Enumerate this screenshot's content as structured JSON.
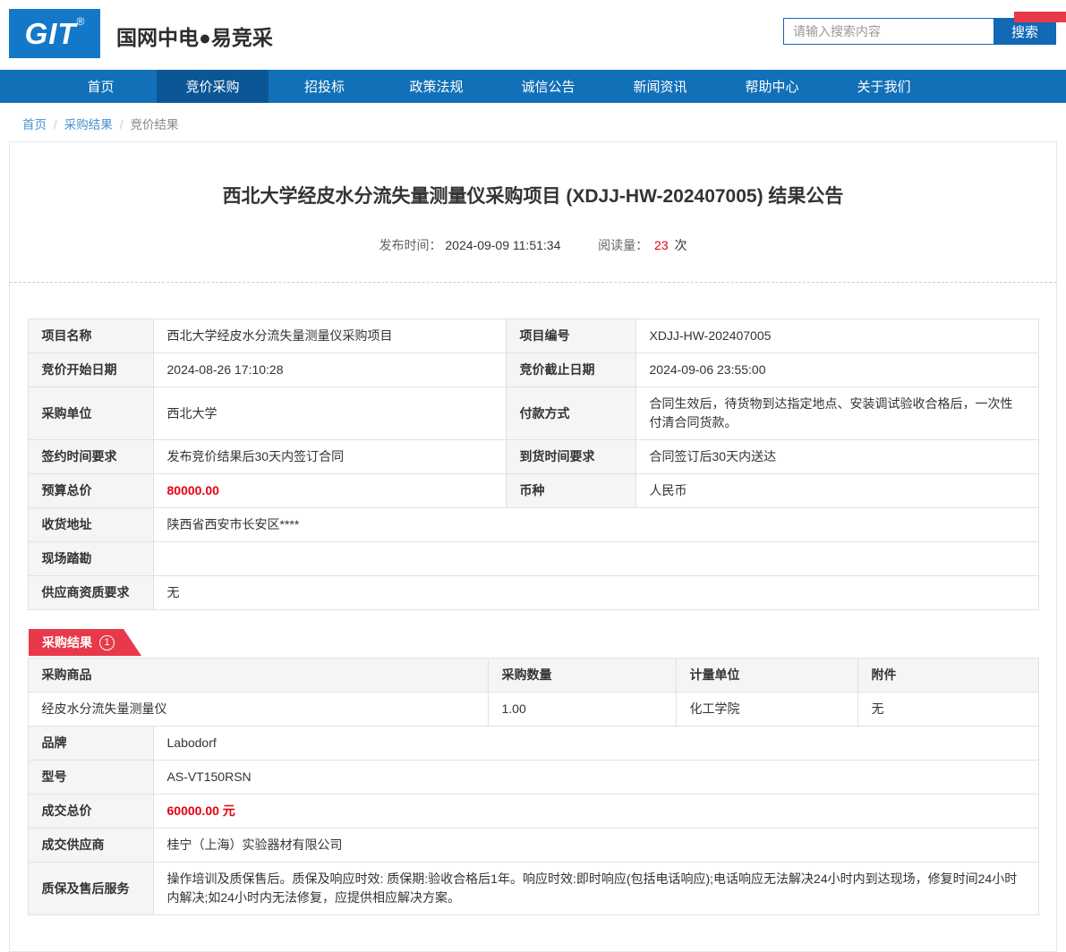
{
  "colors": {
    "nav_blue": "#1270b8",
    "nav_active_blue": "#0b5795",
    "logo_blue": "#1478c8",
    "accent_red": "#e8394a",
    "price_red": "#e60012"
  },
  "header": {
    "logo_text": "GIT",
    "logo_reg": "®",
    "site_title": "国网中电●易竞采",
    "search_placeholder": "请输入搜索内容",
    "search_button": "搜索"
  },
  "nav": {
    "items": [
      "首页",
      "竞价采购",
      "招投标",
      "政策法规",
      "诚信公告",
      "新闻资讯",
      "帮助中心",
      "关于我们"
    ],
    "active": "竞价采购"
  },
  "breadcrumb": {
    "items": [
      "首页",
      "采购结果",
      "竞价结果"
    ]
  },
  "article": {
    "title": "西北大学经皮水分流失量测量仪采购项目 (XDJJ-HW-202407005) 结果公告",
    "meta": {
      "publish_label": "发布时间：",
      "publish_time": "2024-09-09 11:51:34",
      "views_label": "阅读量：",
      "views": "23",
      "views_unit": "次"
    }
  },
  "info": {
    "project_name_label": "项目名称",
    "project_name": "西北大学经皮水分流失量测量仪采购项目",
    "project_no_label": "项目编号",
    "project_no": "XDJJ-HW-202407005",
    "start_label": "竞价开始日期",
    "start": "2024-08-26 17:10:28",
    "end_label": "竞价截止日期",
    "end": "2024-09-06 23:55:00",
    "buyer_label": "采购单位",
    "buyer": "西北大学",
    "payment_label": "付款方式",
    "payment": "合同生效后，待货物到达指定地点、安装调试验收合格后，一次性付清合同货款。",
    "sign_label": "签约时间要求",
    "sign": "发布竞价结果后30天内签订合同",
    "delivery_label": "到货时间要求",
    "delivery": "合同签订后30天内送达",
    "budget_label": "预算总价",
    "budget": "80000.00",
    "currency_label": "币种",
    "currency": "人民币",
    "address_label": "收货地址",
    "address": "陕西省西安市长安区****",
    "survey_label": "现场踏勘",
    "survey": "",
    "qualification_label": "供应商资质要求",
    "qualification": "无"
  },
  "result": {
    "badge": "采购结果",
    "badge_count": "1",
    "columns": [
      "采购商品",
      "采购数量",
      "计量单位",
      "附件"
    ],
    "item": {
      "name": "经皮水分流失量测量仪",
      "qty": "1.00",
      "unit": "化工学院",
      "attachment": "无"
    },
    "brand_label": "品牌",
    "brand": "Labodorf",
    "model_label": "型号",
    "model": "AS-VT150RSN",
    "price_label": "成交总价",
    "price": "60000.00 元",
    "supplier_label": "成交供应商",
    "supplier": "桂宁（上海）实验器材有限公司",
    "warranty_label": "质保及售后服务",
    "warranty": "操作培训及质保售后。质保及响应时效: 质保期:验收合格后1年。响应时效:即时响应(包括电话响应);电话响应无法解决24小时内到达现场，修复时间24小时内解决;如24小时内无法修复，应提供相应解决方案。"
  }
}
